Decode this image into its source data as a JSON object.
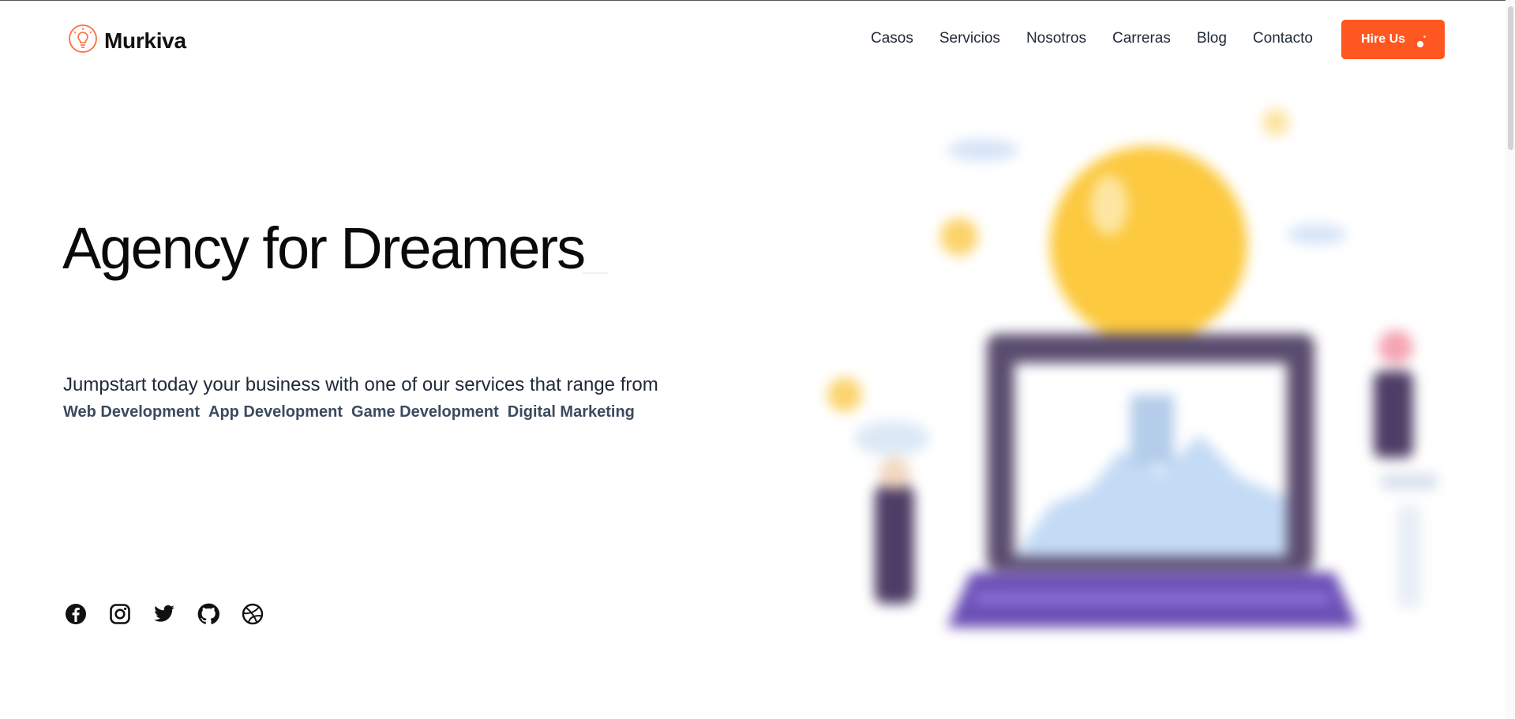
{
  "brand": {
    "name": "Murkiva",
    "accent": "#ff5722"
  },
  "nav": {
    "items": [
      {
        "label": "Casos"
      },
      {
        "label": "Servicios"
      },
      {
        "label": "Nosotros"
      },
      {
        "label": "Carreras"
      },
      {
        "label": "Blog"
      },
      {
        "label": "Contacto"
      }
    ],
    "cta_label": "Hire Us"
  },
  "hero": {
    "title": "Agency for Dreamers",
    "subtitle": "Jumpstart today your business with one of our services that range from",
    "services": [
      "Web Development",
      "App Development",
      "Game Development",
      "Digital Marketing"
    ]
  },
  "social": {
    "icons": [
      "facebook-icon",
      "instagram-icon",
      "twitter-icon",
      "github-icon",
      "dribbble-icon"
    ]
  }
}
